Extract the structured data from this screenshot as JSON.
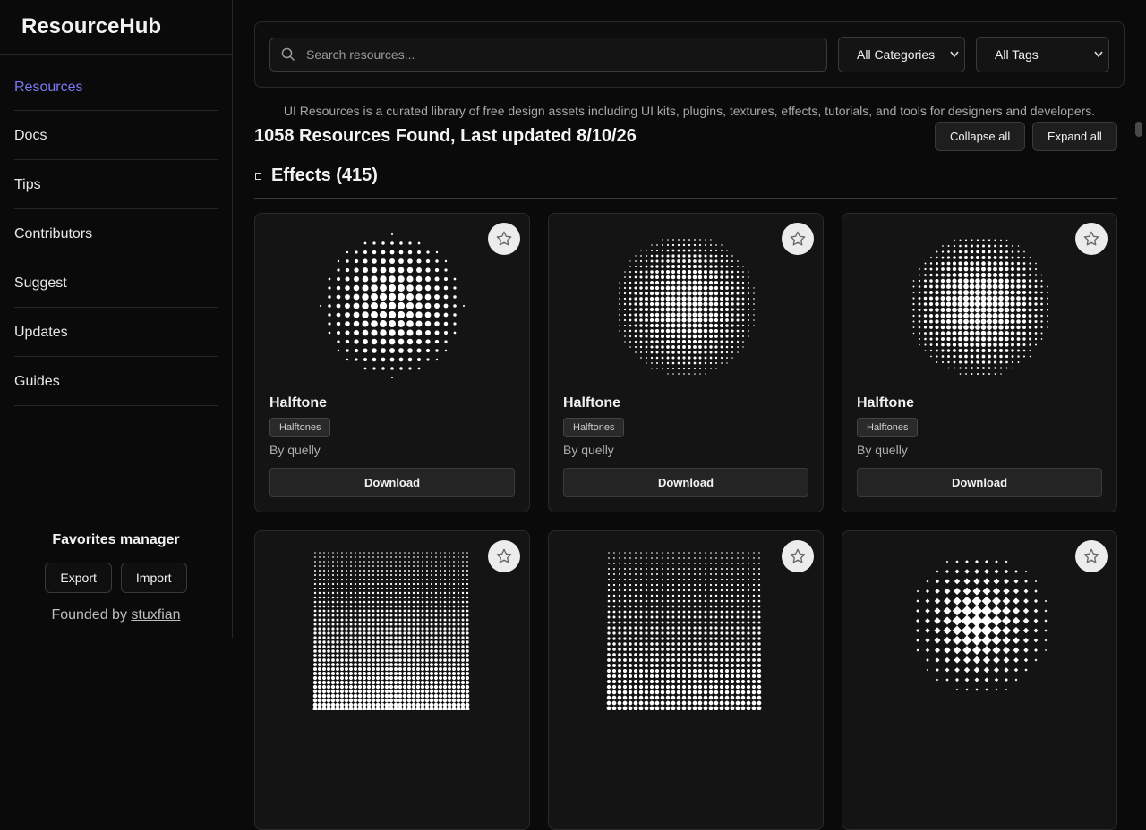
{
  "brand": "ResourceHub",
  "nav": [
    {
      "label": "Resources",
      "active": true
    },
    {
      "label": "Docs"
    },
    {
      "label": "Tips"
    },
    {
      "label": "Contributors"
    },
    {
      "label": "Suggest"
    },
    {
      "label": "Updates"
    },
    {
      "label": "Guides"
    }
  ],
  "favorites": {
    "title": "Favorites manager",
    "export_label": "Export",
    "import_label": "Import",
    "founded_prefix": "Founded by",
    "founder": "stuxfian"
  },
  "filters": {
    "search_placeholder": "Search resources...",
    "category": "All Categories",
    "tags": "All Tags"
  },
  "description": "UI Resources is a curated library of free design assets including UI kits, plugins, textures, effects, tutorials, and tools for designers and developers.",
  "results_text": "1058 Resources Found, Last updated 8/10/26",
  "collapse_label": "Collapse all",
  "expand_label": "Expand all",
  "section": {
    "title": "Effects (415)"
  },
  "cards": [
    {
      "name": "Halftone",
      "tag": "Halftones",
      "author": "By quelly",
      "download": "Download"
    },
    {
      "name": "Halftone",
      "tag": "Halftones",
      "author": "By quelly",
      "download": "Download"
    },
    {
      "name": "Halftone",
      "tag": "Halftones",
      "author": "By quelly",
      "download": "Download"
    }
  ],
  "icons": {
    "search": "search-icon",
    "star": "star-icon",
    "chevron": "chevron-down-icon"
  },
  "colors": {
    "accent": "#7c78f5",
    "background": "#0a0a0a",
    "card": "#141414"
  }
}
